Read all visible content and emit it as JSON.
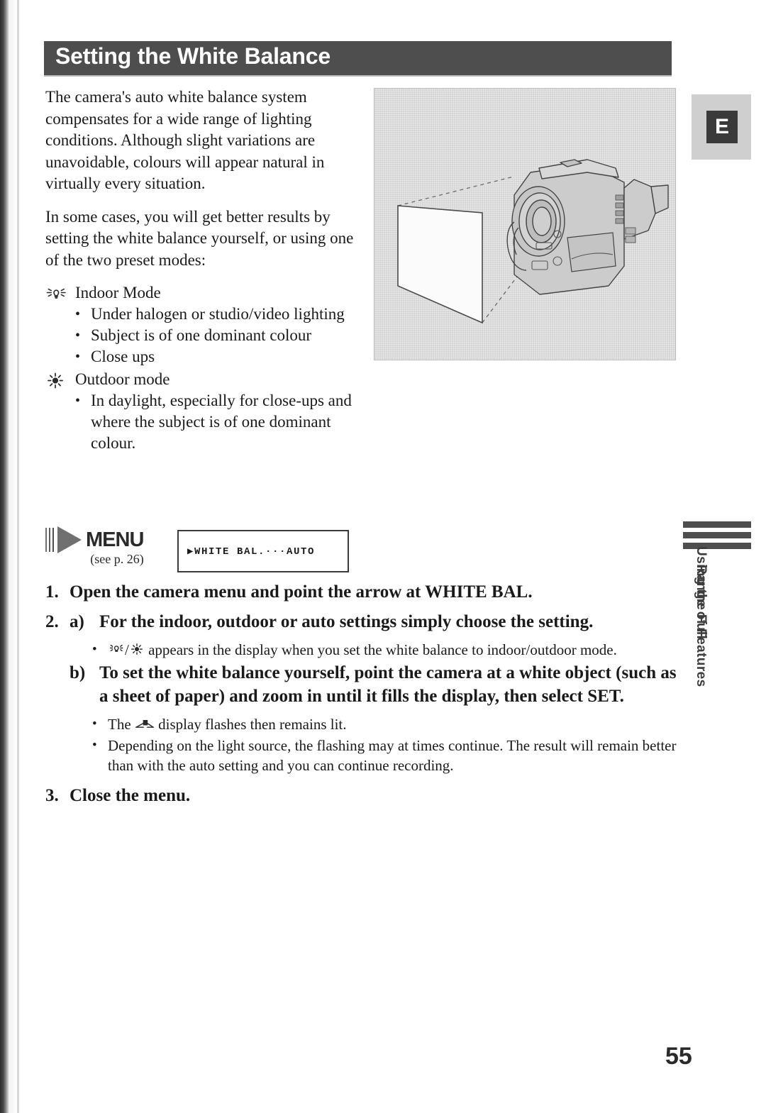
{
  "page": {
    "header_title": "Setting the White Balance",
    "page_number": "55",
    "side_tab_line1": "Using the Full",
    "side_tab_line2": "Range of Features",
    "language_badge": "E"
  },
  "intro": {
    "paragraph1": "The camera's auto white balance system compensates for a wide range of lighting conditions. Although slight variations are unavoidable, colours will appear natural in virtually every situation.",
    "paragraph2": "In some cases, you will get better results by setting the white balance yourself, or using one of the two preset modes:"
  },
  "modes": [
    {
      "icon": "light-bulb-icon",
      "label": "Indoor Mode",
      "bullets": [
        "Under halogen or studio/video lighting",
        "Subject is of one dominant colour",
        "Close ups"
      ]
    },
    {
      "icon": "sun-icon",
      "label": "Outdoor mode",
      "bullets": [
        "In daylight, especially for close-ups and where the subject is of one dominant colour."
      ]
    }
  ],
  "menu": {
    "logo_word": "MENU",
    "see_page": "(see p. 26)",
    "display_text": "▶WHITE BAL.···AUTO"
  },
  "steps": {
    "step1": {
      "number": "1.",
      "text": "Open the camera menu and point the arrow at WHITE BAL."
    },
    "step2": {
      "number": "2.",
      "a_label": "a)",
      "a_text": "For the indoor, outdoor or auto settings simply choose the setting.",
      "a_note": "appears in the display when you set the white balance to indoor/outdoor mode.",
      "a_note_prefix": "",
      "b_label": "b)",
      "b_text": "To set the white balance yourself, point the camera at a white object (such as a sheet of paper) and zoom in until it fills the display, then select SET.",
      "b_note1_before": "The",
      "b_note1_after": "display flashes then remains lit.",
      "b_note2": "Depending on the light source, the flashing may at times continue. The result will remain better than with the auto setting and you can continue recording."
    },
    "step3": {
      "number": "3.",
      "text": "Close the menu."
    }
  },
  "figure": {
    "name": "camcorder-pointing-at-white-paper-illustration",
    "caption": ""
  },
  "bullet_char": "•",
  "colors": {
    "header_band": "#4e4e4e",
    "figure_bg": "#d5d5d5",
    "text": "#1a1a1a",
    "badge_bg": "#3a3a3a"
  }
}
